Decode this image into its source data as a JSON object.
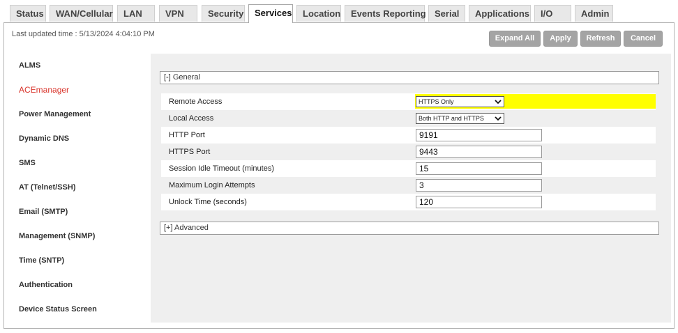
{
  "tabs": [
    {
      "label": "Status"
    },
    {
      "label": "WAN/Cellular"
    },
    {
      "label": "LAN"
    },
    {
      "label": "VPN"
    },
    {
      "label": "Security"
    },
    {
      "label": "Services",
      "active": true
    },
    {
      "label": "Location"
    },
    {
      "label": "Events Reporting"
    },
    {
      "label": "Serial"
    },
    {
      "label": "Applications"
    },
    {
      "label": "I/O"
    },
    {
      "label": "Admin"
    }
  ],
  "status": {
    "last_updated": "Last updated time : 5/13/2024 4:04:10 PM"
  },
  "toolbar": {
    "expand_all": "Expand All",
    "apply": "Apply",
    "refresh": "Refresh",
    "cancel": "Cancel"
  },
  "sidebar": {
    "items": [
      {
        "label": "ALMS"
      },
      {
        "label": "ACEmanager",
        "active": true
      },
      {
        "label": "Power Management"
      },
      {
        "label": "Dynamic DNS"
      },
      {
        "label": "SMS"
      },
      {
        "label": "AT (Telnet/SSH)"
      },
      {
        "label": "Email (SMTP)"
      },
      {
        "label": "Management (SNMP)"
      },
      {
        "label": "Time (SNTP)"
      },
      {
        "label": "Authentication"
      },
      {
        "label": "Device Status Screen"
      }
    ]
  },
  "general": {
    "header": "[-] General",
    "rows": [
      {
        "label": "Remote Access",
        "type": "select",
        "value": "HTTPS Only",
        "highlight": true
      },
      {
        "label": "Local Access",
        "type": "select",
        "value": "Both HTTP and HTTPS"
      },
      {
        "label": "HTTP Port",
        "type": "input",
        "value": "9191"
      },
      {
        "label": "HTTPS Port",
        "type": "input",
        "value": "9443"
      },
      {
        "label": "Session Idle Timeout (minutes)",
        "type": "input",
        "value": "15"
      },
      {
        "label": "Maximum Login Attempts",
        "type": "input",
        "value": "3"
      },
      {
        "label": "Unlock Time (seconds)",
        "type": "input",
        "value": "120"
      }
    ]
  },
  "advanced": {
    "header": "[+] Advanced"
  },
  "colors": {
    "highlight": "#ffff00",
    "active_link": "#d9342b",
    "button_gray": "#a4a4a4"
  }
}
